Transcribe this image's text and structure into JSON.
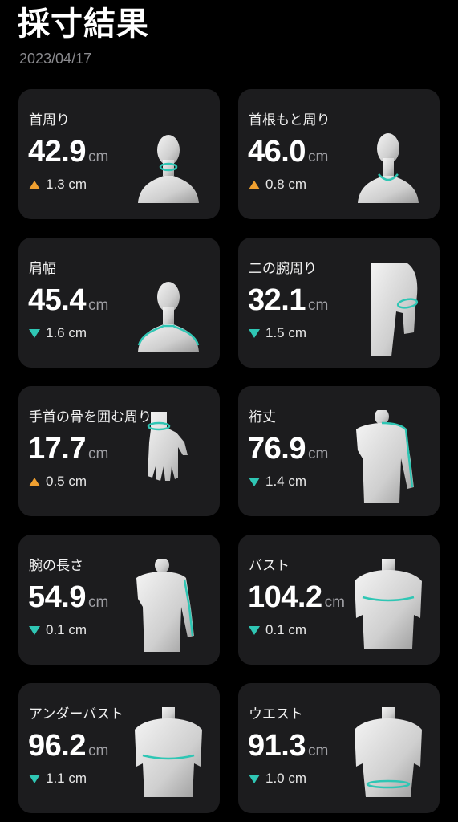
{
  "header": {
    "title": "採寸結果",
    "date": "2023/04/17"
  },
  "colors": {
    "increase": "#f0a030",
    "decrease": "#2fc6b4",
    "card_bg": "#1c1c1e"
  },
  "cards": [
    {
      "label": "首周り",
      "value": "42.9",
      "unit": "cm",
      "delta": "1.3 cm",
      "direction": "up",
      "figure": "neck-figure-icon"
    },
    {
      "label": "首根もと周り",
      "value": "46.0",
      "unit": "cm",
      "delta": "0.8 cm",
      "direction": "up",
      "figure": "neck-base-figure-icon"
    },
    {
      "label": "肩幅",
      "value": "45.4",
      "unit": "cm",
      "delta": "1.6 cm",
      "direction": "down",
      "figure": "shoulder-width-figure-icon"
    },
    {
      "label": "二の腕周り",
      "value": "32.1",
      "unit": "cm",
      "delta": "1.5 cm",
      "direction": "down",
      "figure": "upper-arm-figure-icon"
    },
    {
      "label": "手首の骨を囲む周り",
      "value": "17.7",
      "unit": "cm",
      "delta": "0.5 cm",
      "direction": "up",
      "figure": "wrist-figure-icon"
    },
    {
      "label": "裄丈",
      "value": "76.9",
      "unit": "cm",
      "delta": "1.4 cm",
      "direction": "down",
      "figure": "sleeve-length-figure-icon"
    },
    {
      "label": "腕の長さ",
      "value": "54.9",
      "unit": "cm",
      "delta": "0.1 cm",
      "direction": "down",
      "figure": "arm-length-figure-icon"
    },
    {
      "label": "バスト",
      "value": "104.2",
      "unit": "cm",
      "delta": "0.1 cm",
      "direction": "down",
      "figure": "bust-figure-icon"
    },
    {
      "label": "アンダーバスト",
      "value": "96.2",
      "unit": "cm",
      "delta": "1.1 cm",
      "direction": "down",
      "figure": "underbust-figure-icon"
    },
    {
      "label": "ウエスト",
      "value": "91.3",
      "unit": "cm",
      "delta": "1.0 cm",
      "direction": "down",
      "figure": "waist-figure-icon"
    }
  ]
}
